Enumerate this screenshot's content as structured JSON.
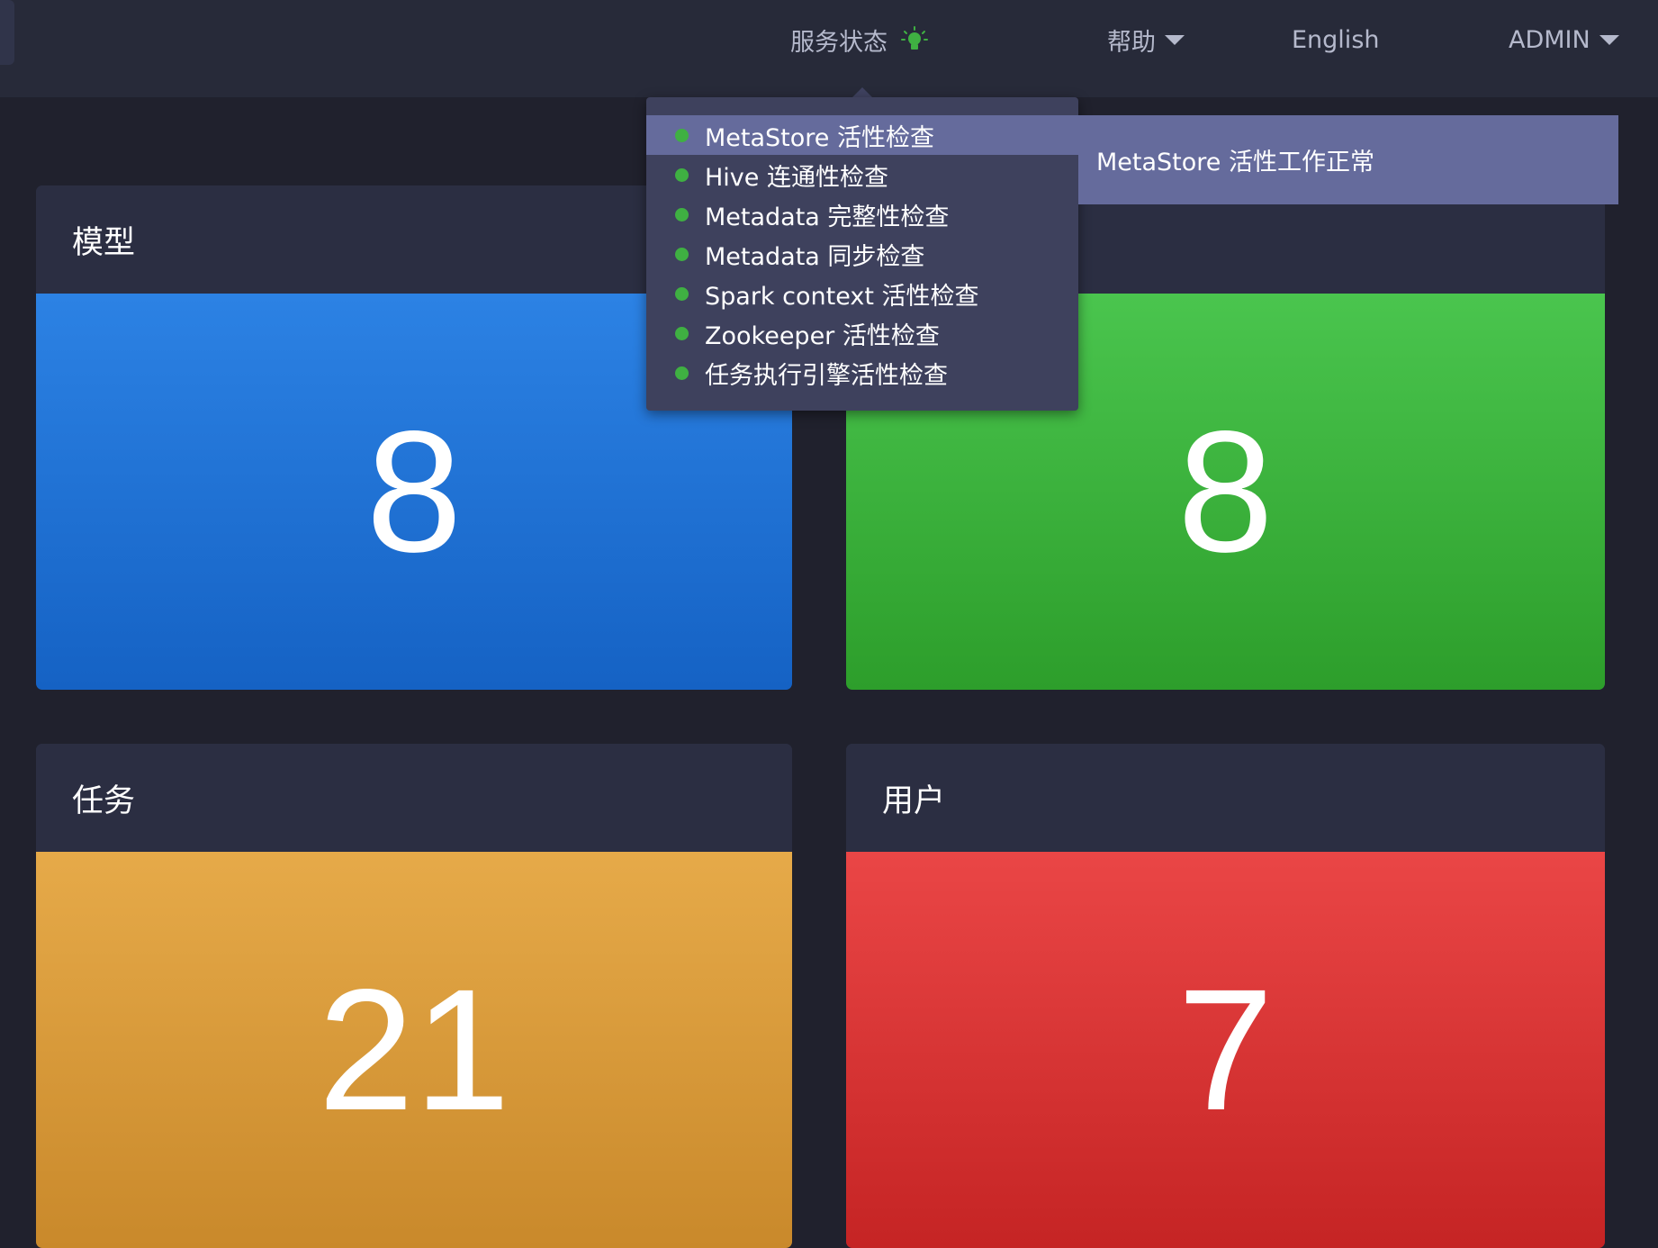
{
  "navbar": {
    "service_status_label": "服务状态",
    "service_status_color": "#3fb042",
    "help_label": "帮助",
    "language_label": "English",
    "user_label": "ADMIN"
  },
  "cards": {
    "models": {
      "title": "模型",
      "count": "8",
      "color": "#2c82e4"
    },
    "cubes": {
      "title": "",
      "count": "8",
      "color": "#4ac54e"
    },
    "jobs": {
      "title": "任务",
      "count": "21",
      "color": "#e6aa49"
    },
    "users": {
      "title": "用户",
      "count": "7",
      "color": "#ea4646"
    }
  },
  "status_menu": {
    "items": [
      {
        "label": "MetaStore 活性检查",
        "status": "ok"
      },
      {
        "label": "Hive 连通性检查",
        "status": "ok"
      },
      {
        "label": "Metadata 完整性检查",
        "status": "ok"
      },
      {
        "label": "Metadata 同步检查",
        "status": "ok"
      },
      {
        "label": "Spark context 活性检查",
        "status": "ok"
      },
      {
        "label": "Zookeeper 活性检查",
        "status": "ok"
      },
      {
        "label": "任务执行引擎活性检查",
        "status": "ok"
      }
    ],
    "hovered_index": 0,
    "tooltip": "MetaStore 活性工作正常"
  },
  "icons": {
    "status": "lightbulb-icon",
    "item_status": "green-dot-icon",
    "dropdown": "caret-down-icon"
  }
}
